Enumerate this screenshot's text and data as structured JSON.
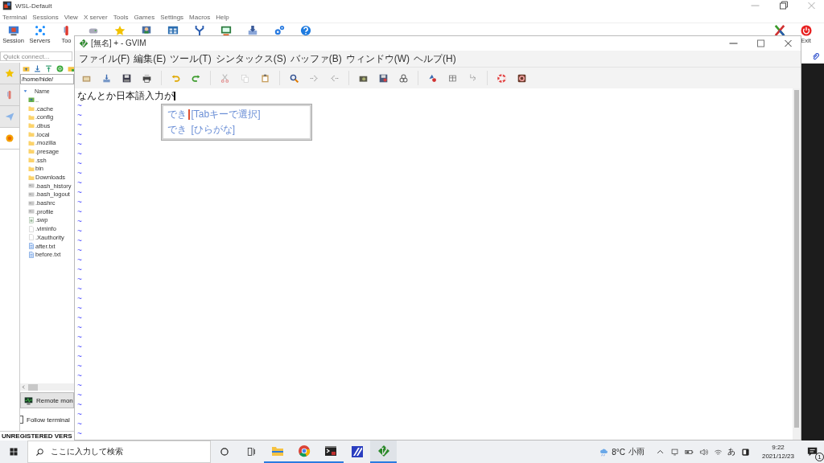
{
  "moba": {
    "title": "WSL-Default",
    "menu": [
      "Terminal",
      "Sessions",
      "View",
      "X server",
      "Tools",
      "Games",
      "Settings",
      "Macros",
      "Help"
    ],
    "toolbar": [
      {
        "label": "Session"
      },
      {
        "label": "Servers"
      },
      {
        "label": "Too"
      }
    ],
    "exit_label": "Exit",
    "quick_connect": {
      "placeholder": "Quick connect..."
    },
    "side_tabs": [
      {
        "selected": false
      },
      {
        "selected": false
      },
      {
        "selected": false
      },
      {
        "selected": true
      }
    ],
    "path": "/home/hide/",
    "column": "Name",
    "files": [
      {
        "name": "..",
        "kind": "up"
      },
      {
        "name": ".cache",
        "kind": "folder"
      },
      {
        "name": ".config",
        "kind": "folder"
      },
      {
        "name": ".dbus",
        "kind": "folder"
      },
      {
        "name": ".local",
        "kind": "folder"
      },
      {
        "name": ".mozilla",
        "kind": "folder"
      },
      {
        "name": ".presage",
        "kind": "folder"
      },
      {
        "name": ".ssh",
        "kind": "folder"
      },
      {
        "name": "bin",
        "kind": "folder"
      },
      {
        "name": "Downloads",
        "kind": "folder"
      },
      {
        "name": ".bash_history",
        "kind": "file"
      },
      {
        "name": ".bash_logout",
        "kind": "file"
      },
      {
        "name": ".bashrc",
        "kind": "file"
      },
      {
        "name": ".profile",
        "kind": "file"
      },
      {
        "name": ".swp",
        "kind": "swap"
      },
      {
        "name": ".viminfo",
        "kind": "doc"
      },
      {
        "name": ".Xauthority",
        "kind": "doc"
      },
      {
        "name": "after.txt",
        "kind": "text"
      },
      {
        "name": "before.txt",
        "kind": "text"
      }
    ],
    "remote_monitor": "Remote mon",
    "follow_terminal": {
      "label": "Follow terminal",
      "checked": false
    },
    "status": "UNREGISTERED VERS"
  },
  "gvim": {
    "title": "[無名] + - GVIM",
    "menu": [
      "ファイル(F)",
      "編集(E)",
      "ツール(T)",
      "シンタックス(S)",
      "バッファ(B)",
      "ウィンドウ(W)",
      "ヘルプ(H)"
    ],
    "lines": [
      "なんとか日本語入力が"
    ],
    "tildes": [
      "~",
      "~",
      "~",
      "~",
      "~",
      "~",
      "~",
      "~",
      "~",
      "~",
      "~",
      "~",
      "~",
      "~",
      "~",
      "~",
      "~",
      "~",
      "~",
      "~",
      "~",
      "~",
      "~",
      "~",
      "~",
      "~",
      "~",
      "~",
      "~",
      "~",
      "~",
      "~",
      "~",
      "~",
      "~"
    ],
    "completion": [
      {
        "word": "でき",
        "hint": "[Tabキーで選択]",
        "caret": true
      },
      {
        "word": "でき",
        "hint": "[ひらがな]",
        "caret": false
      }
    ]
  },
  "taskbar": {
    "search": {
      "placeholder": "ここに入力して検索"
    },
    "apps": [
      {
        "kind": "explorer",
        "running": true,
        "selected": false
      },
      {
        "kind": "chrome",
        "running": true,
        "selected": false
      },
      {
        "kind": "terminal",
        "running": true,
        "selected": false
      },
      {
        "kind": "editor",
        "running": false,
        "selected": false
      },
      {
        "kind": "vim",
        "running": true,
        "selected": true
      }
    ],
    "temperature": "8°C",
    "weather": "小雨",
    "ime": "あ",
    "time": "9:22",
    "date": "2021/12/23",
    "notifications": "1"
  }
}
